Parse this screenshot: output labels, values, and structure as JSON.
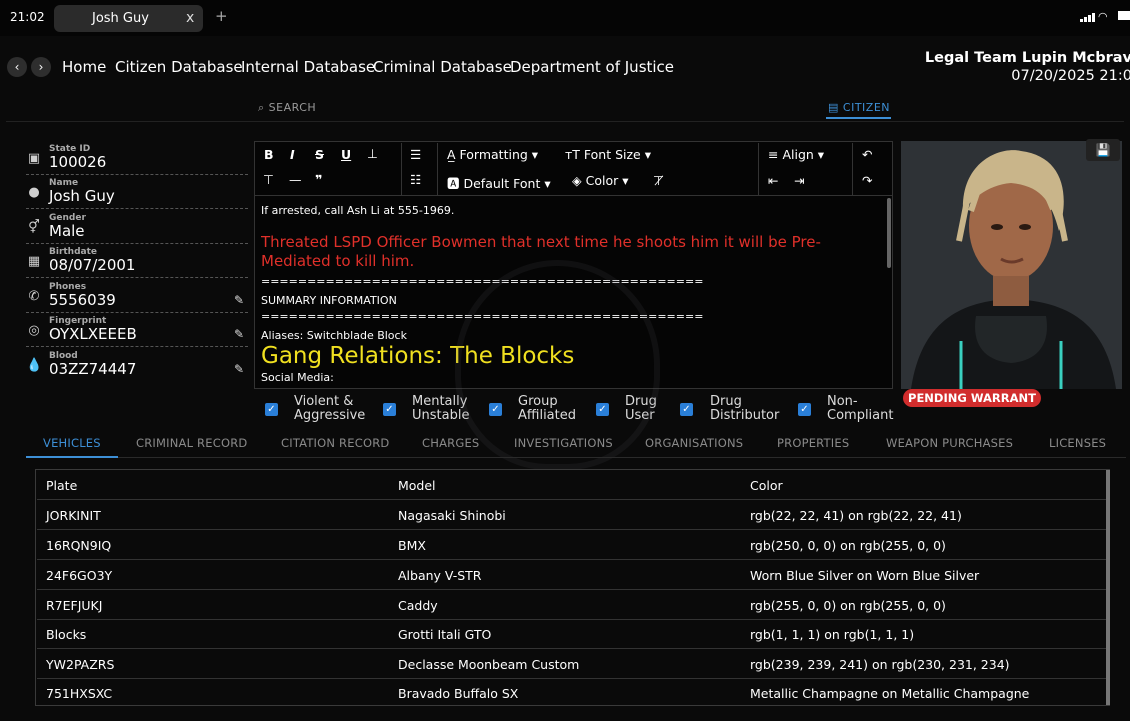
{
  "status": {
    "time": "21:02",
    "tab_title": "Josh Guy",
    "tab_close": "x",
    "new_tab": "+"
  },
  "nav": {
    "back": "‹",
    "forward": "›",
    "items": [
      "Home",
      "Citizen Database",
      "Internal Database",
      "Criminal Database",
      "Department of Justice"
    ],
    "user": "Legal Team Lupin Mcbrav",
    "datetime": "07/20/2025 21:0",
    "search_label": "SEARCH",
    "citizen_label": "CITIZEN"
  },
  "citizen": {
    "fields": [
      {
        "label": "State ID",
        "value": "100026",
        "icon": "id-card-icon",
        "editable": false
      },
      {
        "label": "Name",
        "value": "Josh Guy",
        "icon": "person-icon",
        "editable": false
      },
      {
        "label": "Gender",
        "value": "Male",
        "icon": "gender-icon",
        "editable": false
      },
      {
        "label": "Birthdate",
        "value": "08/07/2001",
        "icon": "calendar-icon",
        "editable": false
      },
      {
        "label": "Phones",
        "value": "5556039",
        "icon": "phone-icon",
        "editable": true
      },
      {
        "label": "Fingerprint",
        "value": "OYXLXEEEB",
        "icon": "fingerprint-icon",
        "editable": true
      },
      {
        "label": "Blood",
        "value": "03ZZ74447",
        "icon": "blood-drop-icon",
        "editable": true
      }
    ]
  },
  "editor": {
    "toolbar": {
      "formatting": "Formatting",
      "font_size": "Font Size",
      "default_font": "Default Font",
      "color": "Color",
      "align": "Align"
    },
    "lines": [
      {
        "text": "If arrested, call Ash Li at 555-1969.",
        "style": "normal"
      },
      {
        "text": "Threated LSPD Officer Bowmen that next time he shoots him it will be Pre-Mediated to kill him.",
        "style": "red"
      },
      {
        "text": "================================================",
        "style": "normal"
      },
      {
        "text": "SUMMARY INFORMATION",
        "style": "normal"
      },
      {
        "text": "================================================",
        "style": "normal"
      },
      {
        "text": "Aliases: Switchblade Block",
        "style": "normal"
      },
      {
        "text": "Gang Relations: The Blocks",
        "style": "yellow"
      },
      {
        "text": "Social Media:",
        "style": "normal"
      }
    ]
  },
  "warrant": "PENDING WARRANT",
  "flags": [
    {
      "label": "Violent &\nAggressive",
      "checked": true
    },
    {
      "label": "Mentally\nUnstable",
      "checked": true
    },
    {
      "label": "Group\nAffiliated",
      "checked": true
    },
    {
      "label": "Drug\nUser",
      "checked": true
    },
    {
      "label": "Drug\nDistributor",
      "checked": true
    },
    {
      "label": "Non-\nCompliant",
      "checked": true
    }
  ],
  "tabs": [
    "VEHICLES",
    "CRIMINAL RECORD",
    "CITATION RECORD",
    "CHARGES",
    "INVESTIGATIONS",
    "ORGANISATIONS",
    "PROPERTIES",
    "WEAPON PURCHASES",
    "LICENSES"
  ],
  "table": {
    "headers": [
      "Plate",
      "Model",
      "Color"
    ],
    "rows": [
      [
        "JORKINIT",
        "Nagasaki Shinobi",
        "rgb(22, 22, 41) on rgb(22, 22, 41)"
      ],
      [
        "16RQN9IQ",
        "BMX",
        "rgb(250, 0, 0) on rgb(255, 0, 0)"
      ],
      [
        "24F6GO3Y",
        "Albany V-STR",
        "Worn Blue Silver on Worn Blue Silver"
      ],
      [
        "R7EFJUKJ",
        "Caddy",
        "rgb(255, 0, 0) on rgb(255, 0, 0)"
      ],
      [
        "Blocks",
        "Grotti Itali GTO",
        "rgb(1, 1, 1) on rgb(1, 1, 1)"
      ],
      [
        "YW2PAZRS",
        "Declasse Moonbeam Custom",
        "rgb(239, 239, 241) on rgb(230, 231, 234)"
      ],
      [
        "751HXSXC",
        "Bravado Buffalo SX",
        "Metallic Champagne on Metallic Champagne"
      ]
    ]
  },
  "colors": {
    "accent": "#3d8fd6",
    "warrant": "#d12d2d",
    "red_text": "#e0302a",
    "yellow_text": "#f0e020"
  }
}
